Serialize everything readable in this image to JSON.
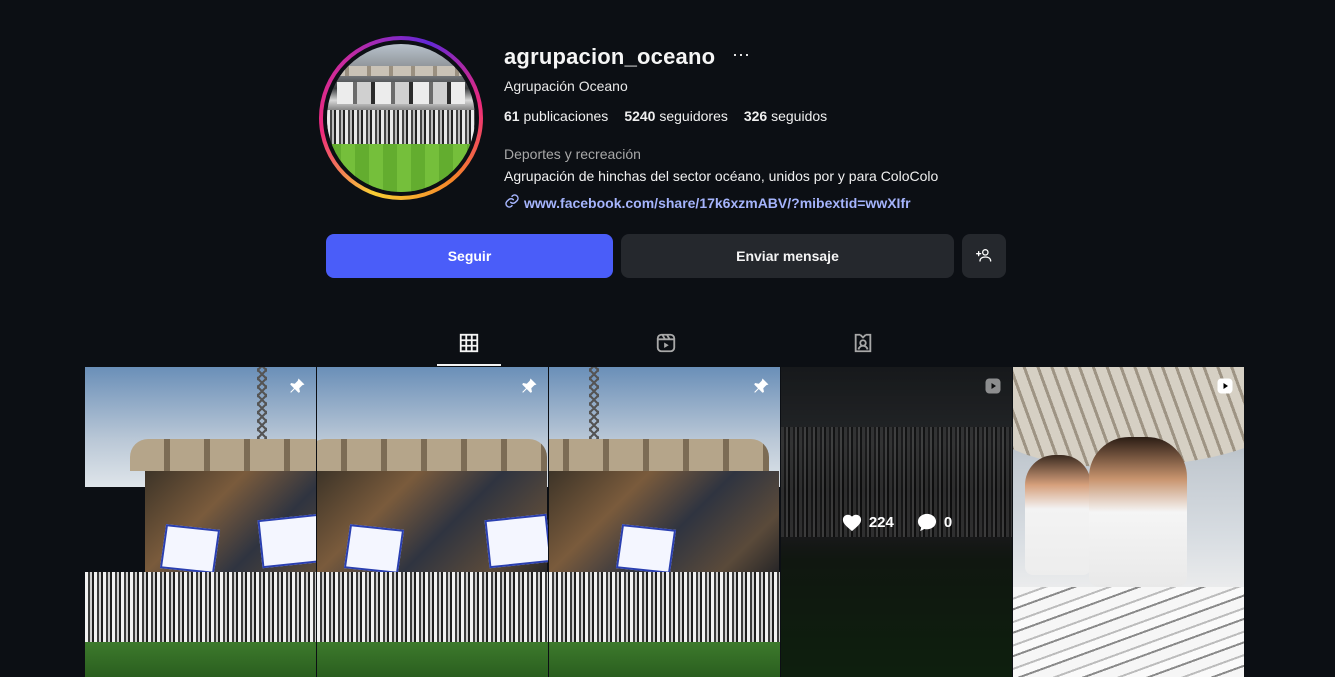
{
  "profile": {
    "username": "agrupacion_oceano",
    "more_label": "···",
    "full_name": "Agrupación Oceano",
    "stats": {
      "posts_count": "61",
      "posts_label": "publicaciones",
      "followers_count": "5240",
      "followers_label": "seguidores",
      "following_count": "326",
      "following_label": "seguidos"
    },
    "category": "Deportes y recreación",
    "bio": "Agrupación de hinchas del sector océano, unidos por y para ColoColo",
    "link": "www.facebook.com/share/17k6xzmABV/?mibextid=wwXIfr"
  },
  "actions": {
    "follow_label": "Seguir",
    "message_label": "Enviar mensaje",
    "add_icon": "person-add-icon"
  },
  "tabs": [
    {
      "icon": "grid-icon",
      "active": true
    },
    {
      "icon": "reels-icon",
      "active": false
    },
    {
      "icon": "tagged-icon",
      "active": false
    }
  ],
  "posts": [
    {
      "type": "pinned"
    },
    {
      "type": "pinned"
    },
    {
      "type": "pinned"
    },
    {
      "type": "reel",
      "hovered": true,
      "likes": "224",
      "comments": "0"
    },
    {
      "type": "reel"
    }
  ],
  "colors": {
    "background": "#0c0f14",
    "follow_button": "#4a5df9",
    "secondary_button": "#25282d",
    "link": "#a5b4fc"
  }
}
